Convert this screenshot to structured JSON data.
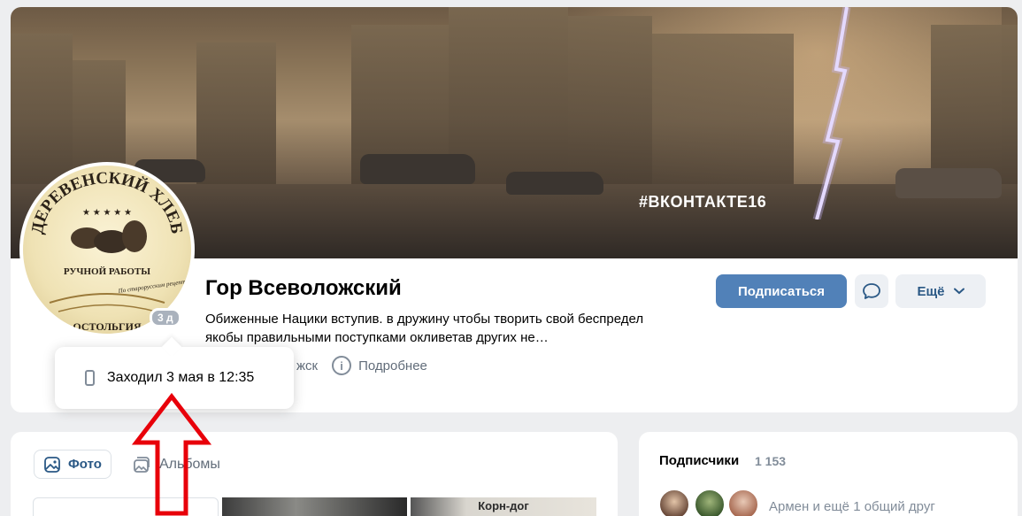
{
  "cover": {
    "hashtag": "#ВКОНТАКТЕ16"
  },
  "avatar": {
    "logo_title": "ДЕРЕВЕНСКИЙ ХЛЕБ",
    "logo_subtitle": "РУЧНОЙ РАБОТЫ",
    "logo_tagline": "По старорусским рецептам",
    "logo_bottom": "ОСТОЛЬГИЯ"
  },
  "profile": {
    "name": "Гор Всеволожский",
    "status": "Обиженные Нацики вступив. в дружину чтобы творить свой беспредел якобы правильными поступками окливетав других не…",
    "online_badge": "3 д",
    "city": "жск",
    "details_label": "Подробнее"
  },
  "actions": {
    "subscribe_label": "Подписаться",
    "more_label": "Ещё"
  },
  "tooltip": {
    "last_seen": "Заходил 3 мая в 12:35"
  },
  "photos": {
    "tab_photo_label": "Фото",
    "tab_albums_label": "Альбомы",
    "thumb_caption": "Корн-дог"
  },
  "subscribers": {
    "title": "Подписчики",
    "count": "1 153",
    "mutual_text": "Армен и ещё 1 общий друг"
  },
  "colors": {
    "accent": "#5181b8",
    "link": "#2a5885",
    "annotation": "#e8000a"
  }
}
